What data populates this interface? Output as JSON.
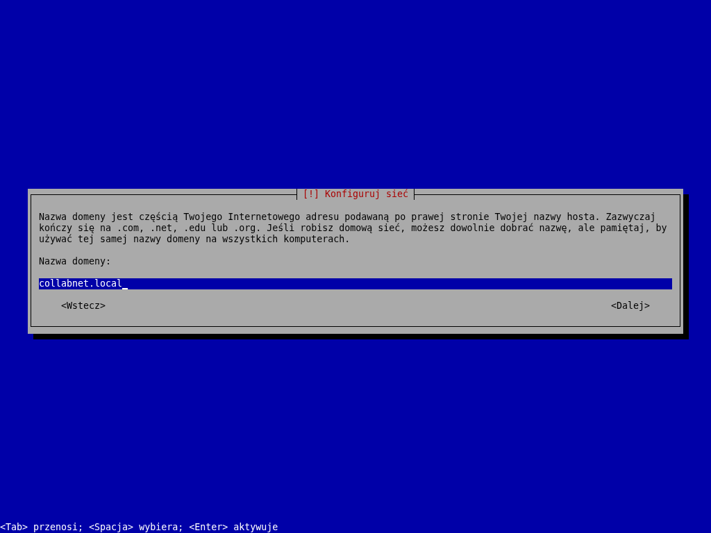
{
  "dialog": {
    "title": "[!] Konfiguruj sieć",
    "description": "Nazwa domeny jest częścią Twojego Internetowego adresu podawaną po prawej stronie Twojej nazwy hosta. Zazwyczaj\nkończy się na .com, .net, .edu lub .org. Jeśli robisz domową sieć, możesz dowolnie dobrać nazwę, ale pamiętaj, by\nużywać tej samej nazwy domeny na wszystkich komputerach.",
    "field_label": "Nazwa domeny:",
    "field": {
      "value": "collabnet.local"
    },
    "buttons": [
      {
        "label": "<Wstecz>"
      },
      {
        "label": "<Dalej>"
      }
    ]
  },
  "status_bar": "<Tab> przenosi; <Spacja> wybiera; <Enter> aktywuje"
}
